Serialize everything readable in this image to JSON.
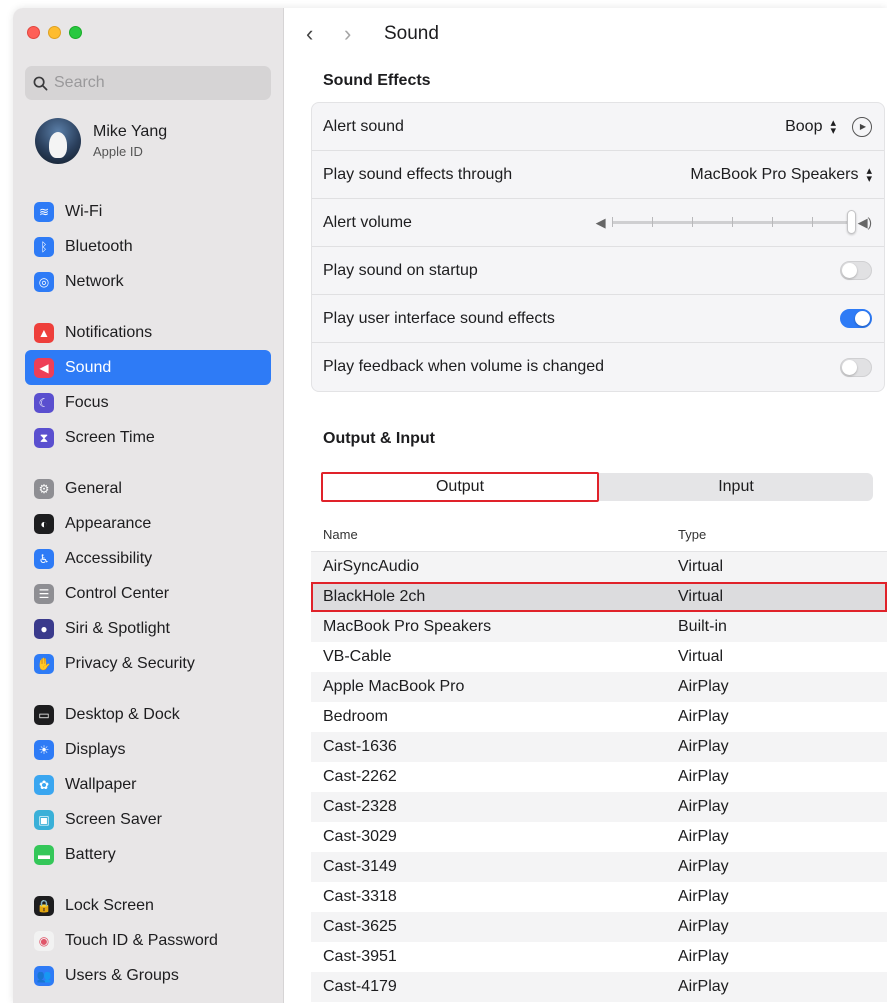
{
  "window": {
    "title": "Sound"
  },
  "search": {
    "placeholder": "Search"
  },
  "profile": {
    "name": "Mike Yang",
    "subtitle": "Apple ID"
  },
  "sidebar": {
    "items": [
      {
        "label": "Wi-Fi",
        "icon": "wifi-icon",
        "color": "#2e7bf6",
        "glyph": "≋"
      },
      {
        "label": "Bluetooth",
        "icon": "bluetooth-icon",
        "color": "#2e7bf6",
        "glyph": "ᛒ"
      },
      {
        "label": "Network",
        "icon": "globe-icon",
        "color": "#2e7bf6",
        "glyph": "◎"
      },
      {
        "label": "Notifications",
        "icon": "bell-icon",
        "color": "#ee3f3b",
        "glyph": "▲"
      },
      {
        "label": "Sound",
        "icon": "speaker-icon",
        "color": "#ee3f57",
        "glyph": "◀"
      },
      {
        "label": "Focus",
        "icon": "moon-icon",
        "color": "#5a4fcf",
        "glyph": "☾"
      },
      {
        "label": "Screen Time",
        "icon": "hourglass-icon",
        "color": "#5a4fcf",
        "glyph": "⧗"
      },
      {
        "label": "General",
        "icon": "gear-icon",
        "color": "#8e8e93",
        "glyph": "⚙"
      },
      {
        "label": "Appearance",
        "icon": "appearance-icon",
        "color": "#1d1d1f",
        "glyph": "◐"
      },
      {
        "label": "Accessibility",
        "icon": "accessibility-icon",
        "color": "#2e7bf6",
        "glyph": "♿"
      },
      {
        "label": "Control Center",
        "icon": "control-center-icon",
        "color": "#8e8e93",
        "glyph": "☰"
      },
      {
        "label": "Siri & Spotlight",
        "icon": "siri-icon",
        "color": "#3a3a8c",
        "glyph": "●"
      },
      {
        "label": "Privacy & Security",
        "icon": "hand-icon",
        "color": "#2e7bf6",
        "glyph": "✋"
      },
      {
        "label": "Desktop & Dock",
        "icon": "dock-icon",
        "color": "#1d1d1f",
        "glyph": "▭"
      },
      {
        "label": "Displays",
        "icon": "sun-icon",
        "color": "#2e7bf6",
        "glyph": "☀"
      },
      {
        "label": "Wallpaper",
        "icon": "wallpaper-icon",
        "color": "#3aa6f0",
        "glyph": "✿"
      },
      {
        "label": "Screen Saver",
        "icon": "screen-saver-icon",
        "color": "#3ab0d8",
        "glyph": "▣"
      },
      {
        "label": "Battery",
        "icon": "battery-icon",
        "color": "#34c759",
        "glyph": "▬"
      },
      {
        "label": "Lock Screen",
        "icon": "lock-icon",
        "color": "#1d1d1f",
        "glyph": "🔒"
      },
      {
        "label": "Touch ID & Password",
        "icon": "fingerprint-icon",
        "color": "#f2f2f2",
        "glyph": "◉"
      },
      {
        "label": "Users & Groups",
        "icon": "users-icon",
        "color": "#2e7bf6",
        "glyph": "👥"
      }
    ]
  },
  "sound_effects": {
    "title": "Sound Effects",
    "alert_sound_label": "Alert sound",
    "alert_sound_value": "Boop",
    "play_through_label": "Play sound effects through",
    "play_through_value": "MacBook Pro Speakers",
    "alert_volume_label": "Alert volume",
    "alert_volume_level": 1.0,
    "startup_label": "Play sound on startup",
    "startup_on": false,
    "ui_sounds_label": "Play user interface sound effects",
    "ui_sounds_on": true,
    "feedback_label": "Play feedback when volume is changed",
    "feedback_on": false
  },
  "output_input": {
    "title": "Output & Input",
    "tab_output": "Output",
    "tab_input": "Input",
    "col_name": "Name",
    "col_type": "Type",
    "devices": [
      {
        "name": "AirSyncAudio",
        "type": "Virtual"
      },
      {
        "name": "BlackHole 2ch",
        "type": "Virtual",
        "highlight": true
      },
      {
        "name": "MacBook Pro Speakers",
        "type": "Built-in"
      },
      {
        "name": "VB-Cable",
        "type": "Virtual"
      },
      {
        "name": "Apple MacBook Pro",
        "type": "AirPlay"
      },
      {
        "name": "Bedroom",
        "type": "AirPlay"
      },
      {
        "name": "Cast-1636",
        "type": "AirPlay"
      },
      {
        "name": "Cast-2262",
        "type": "AirPlay"
      },
      {
        "name": "Cast-2328",
        "type": "AirPlay"
      },
      {
        "name": "Cast-3029",
        "type": "AirPlay"
      },
      {
        "name": "Cast-3149",
        "type": "AirPlay"
      },
      {
        "name": "Cast-3318",
        "type": "AirPlay"
      },
      {
        "name": "Cast-3625",
        "type": "AirPlay"
      },
      {
        "name": "Cast-3951",
        "type": "AirPlay"
      },
      {
        "name": "Cast-4179",
        "type": "AirPlay"
      }
    ]
  },
  "colors": {
    "accent": "#2e7bf6",
    "highlight_border": "#e0222a"
  }
}
